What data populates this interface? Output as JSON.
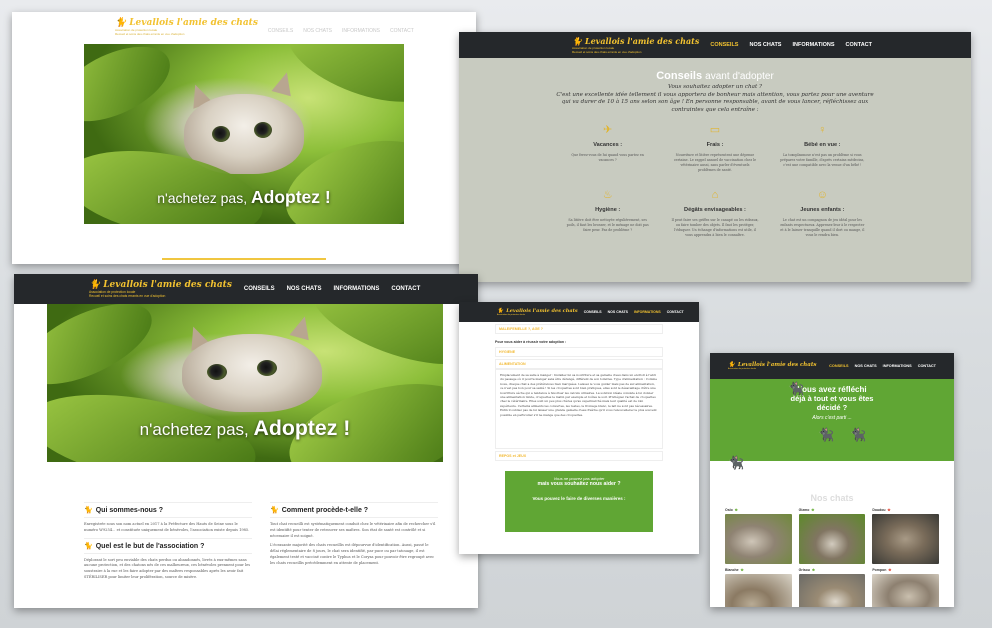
{
  "brand": {
    "name": "Levallois l'amie des chats",
    "tagline_1": "Association de protection locale",
    "tagline_2": "Recueil et soins des chats errants en vue d'adoption"
  },
  "nav": {
    "conseils": "CONSEILS",
    "nos_chats": "NOS CHATS",
    "informations": "INFORMATIONS",
    "contact": "CONTACT"
  },
  "hero": {
    "caption_pre": "n'achetez pas,",
    "caption_strong": "Adoptez !"
  },
  "conseils": {
    "title": "Conseils",
    "title_suffix": "avant d'adopter",
    "intro_1": "Vous souhaitez adopter un chat ?",
    "intro_2": "C'est une excellente idée tellement il vous apportera de bonheur mais attention, vous partez pour une aventure qui va durer de 10 à 15 ans selon son âge ! En personne responsable, avant de vous lancer, réfléchissez aux contraintes que cela entraîne :",
    "items": [
      {
        "icon": "suitcase-icon",
        "glyph": "✈",
        "title": "Vacances :",
        "text": "Que ferez-vous de lui quand vous partez en vacances ?"
      },
      {
        "icon": "wallet-icon",
        "glyph": "▭",
        "title": "Frais :",
        "text": "Nourriture et litière représentent une dépense certaine. Le rappel annuel de vaccination chez le vétérinaire aussi, sans parler d'éventuels problèmes de santé."
      },
      {
        "icon": "baby-icon",
        "glyph": "♀",
        "title": "Bébé en vue :",
        "text": "La toxoplasmose n'est pas un problème si vous préparez votre famille, d'après certains médecins, c'est une compatible avec la venue d'un bébé !"
      },
      {
        "icon": "hygiene-icon",
        "glyph": "♨",
        "title": "Hygiène :",
        "text": "Sa litière doit être nettoyée régulièrement, ses poils, il faut les brosser, et le ménage ne doit pas faire peur. Pas de problème ?"
      },
      {
        "icon": "house-icon",
        "glyph": "⌂",
        "title": "Dégâts envisageables :",
        "text": "Il peut faire ses griffes sur le canapé ou les rideaux, ou faire tomber des objets. Il faut les protéger, l'éduquer. Un échange d'informations est utile, il vous apprendra à bien le connaître."
      },
      {
        "icon": "child-icon",
        "glyph": "☺",
        "title": "Jeunes enfants :",
        "text": "Le chat est un compagnon de jeu idéal pour les enfants respectueux. Apprenez-leur à le respecter et à le laisser tranquille quand il dort ou mange, il vous le rendra bien."
      }
    ]
  },
  "home": {
    "q1": "Qui sommes-nous ?",
    "p1": "Enregistrée sous son nom actuel en 2017 à la Préfecture des Hauts de Seine sous le numéro W9254... et constituée uniquement de bénévoles, l'association existe depuis 1985.",
    "q2": "Quel est le but de l'association ?",
    "p2": "Déplorant le sort peu enviable des chats perdus ou abandonnés, livrés à eux-mêmes sans aucune protection, et des chatons nés de ces malheureux, ces bénévoles prennent pour les soustraire à la rue et les faire adopter par des maîtres responsables après les avoir fait STÉRILISER pour limiter leur prolifération, source de misère.",
    "q3": "Comment procède-t-elle ?",
    "p3": "Tout chat recueilli est systématiquement conduit chez le vétérinaire afin de rechercher s'il est identifié pour tenter de retrouver ses maîtres. Son état de santé est contrôlé et si nécessaire il est soigné.",
    "p3b": "L'écrasante majorité des chats recueillis est dépourvue d'identification. Aussi, passé le délai réglementaire de 8 jours, le chat sera identifié, par puce ou par tatouage, il est également testé et vacciné contre le Typhus et le Coryza pour pouvoir être regroupé avec les chats recueillis précédemment en attente de placement."
  },
  "info": {
    "acc_top": "MALE/FEMELLE ?, AGE ?",
    "lead": "Pour vous aider à réussir votre adoption :",
    "acc_hygiene": "HYGIENE",
    "acc_alimentation": "ALIMENTATION",
    "long_text": "Emplacement de sa salle à manger : Installez lui sa nourriture et sa gamelle d'eau dans un endroit à l'abri du passage où il pourra manger sans être dérangé, différent de son toilettes. Type d'alimentation : Comme nous, chaque chat a des préférences bien marquées. Laissez le vous guider mais pas de sur-alimentation, ce n'est pas bon pour sa santé ! Si les croquettes sont bien pratiques, elles sont le désavantage d'être une nourriture sèche qui a tendance à favoriser les calculs urinaires. La solution idéale consiste à lui donner une alimentation mixte, croquettes le matin par exemple et boîtes le soir. Privilégiez l'achat de croquettes chez le vétérinaire. Elles sont un peu plus chères qu'au supermarché mais leur qualité est de loin supérieure. Certains aliments les convertes, les restes, le fromage blanc, le lait ne sont pas nécessaires. Enfin n'oubliez pas de lui laisser une grande gamelle d'eau fraîche qu'il vous renouvellerez le plus souvent possible en particulier s'il ne mange que des croquettes.",
    "acc_bottom": "REPOS et JEUX",
    "cta_a": "Vous ne pouvez pas adopter",
    "cta_b": "mais vous souhaitez nous aider ?",
    "cta_c": "Vous pouvez le faire de diverses manières :"
  },
  "chats": {
    "banner_1": "Vous avez réfléchi",
    "banner_2": "déjà à tout et vous êtes",
    "banner_3": "décidé ?",
    "banner_4": "Alors c'est parti ...",
    "title": "Nos chats",
    "cats": [
      "Oslo",
      "Gizmo",
      "Doudou",
      "Blanche",
      "Grisou",
      "Pompon"
    ]
  },
  "colors": {
    "accent": "#f2c230",
    "nav_bg": "#25282b",
    "green": "#60a634",
    "conseils_bg": "#c8cbc0"
  }
}
